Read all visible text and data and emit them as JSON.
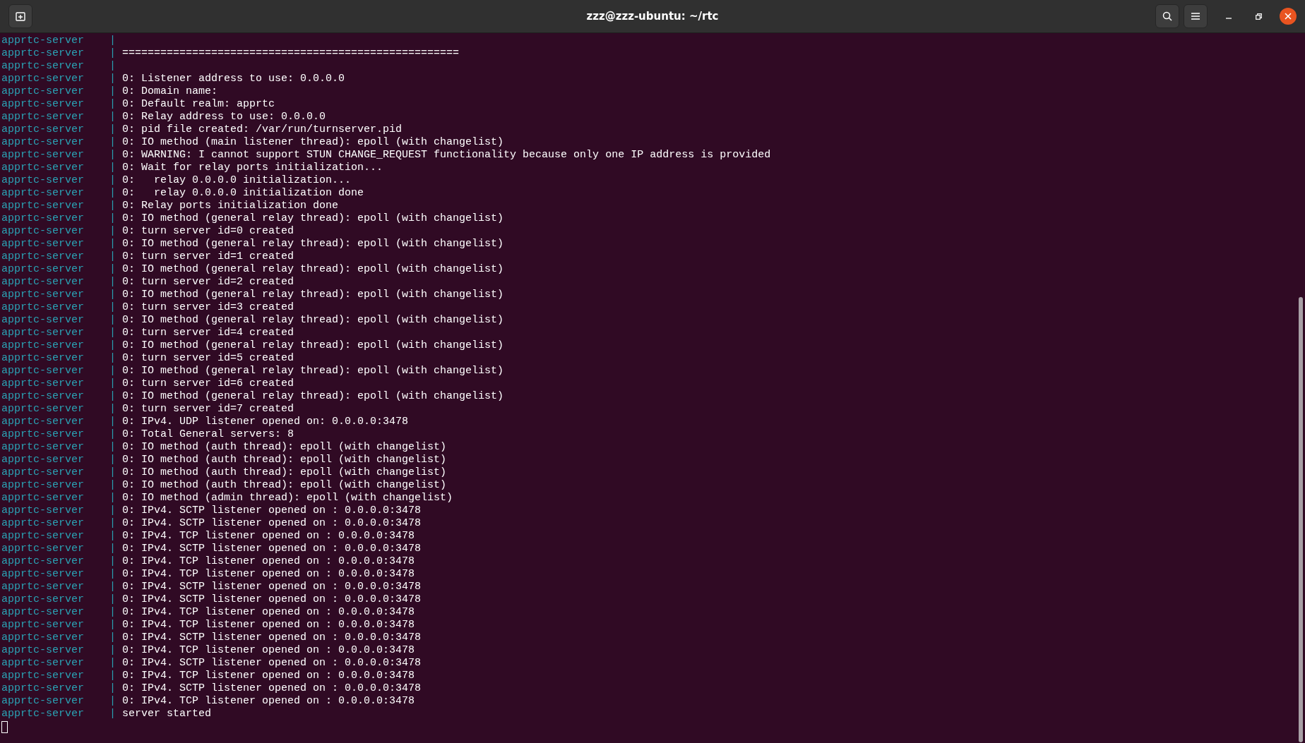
{
  "window": {
    "title": "zzz@zzz-ubuntu: ~/rtc"
  },
  "lines": [
    {
      "source": "apprtc-server",
      "separator": "|"
    },
    {
      "source": "apprtc-server",
      "separator": "|",
      "message": "====================================================="
    },
    {
      "source": "apprtc-server",
      "separator": "|"
    },
    {
      "source": "apprtc-server",
      "separator": "|",
      "message": "0: Listener address to use: 0.0.0.0"
    },
    {
      "source": "apprtc-server",
      "separator": "|",
      "message": "0: Domain name:"
    },
    {
      "source": "apprtc-server",
      "separator": "|",
      "message": "0: Default realm: apprtc"
    },
    {
      "source": "apprtc-server",
      "separator": "|",
      "message": "0: Relay address to use: 0.0.0.0"
    },
    {
      "source": "apprtc-server",
      "separator": "|",
      "message": "0: pid file created: /var/run/turnserver.pid"
    },
    {
      "source": "apprtc-server",
      "separator": "|",
      "message": "0: IO method (main listener thread): epoll (with changelist)"
    },
    {
      "source": "apprtc-server",
      "separator": "|",
      "message": "0: WARNING: I cannot support STUN CHANGE_REQUEST functionality because only one IP address is provided"
    },
    {
      "source": "apprtc-server",
      "separator": "|",
      "message": "0: Wait for relay ports initialization..."
    },
    {
      "source": "apprtc-server",
      "separator": "|",
      "message": "0:   relay 0.0.0.0 initialization..."
    },
    {
      "source": "apprtc-server",
      "separator": "|",
      "message": "0:   relay 0.0.0.0 initialization done"
    },
    {
      "source": "apprtc-server",
      "separator": "|",
      "message": "0: Relay ports initialization done"
    },
    {
      "source": "apprtc-server",
      "separator": "|",
      "message": "0: IO method (general relay thread): epoll (with changelist)"
    },
    {
      "source": "apprtc-server",
      "separator": "|",
      "message": "0: turn server id=0 created"
    },
    {
      "source": "apprtc-server",
      "separator": "|",
      "message": "0: IO method (general relay thread): epoll (with changelist)"
    },
    {
      "source": "apprtc-server",
      "separator": "|",
      "message": "0: turn server id=1 created"
    },
    {
      "source": "apprtc-server",
      "separator": "|",
      "message": "0: IO method (general relay thread): epoll (with changelist)"
    },
    {
      "source": "apprtc-server",
      "separator": "|",
      "message": "0: turn server id=2 created"
    },
    {
      "source": "apprtc-server",
      "separator": "|",
      "message": "0: IO method (general relay thread): epoll (with changelist)"
    },
    {
      "source": "apprtc-server",
      "separator": "|",
      "message": "0: turn server id=3 created"
    },
    {
      "source": "apprtc-server",
      "separator": "|",
      "message": "0: IO method (general relay thread): epoll (with changelist)"
    },
    {
      "source": "apprtc-server",
      "separator": "|",
      "message": "0: turn server id=4 created"
    },
    {
      "source": "apprtc-server",
      "separator": "|",
      "message": "0: IO method (general relay thread): epoll (with changelist)"
    },
    {
      "source": "apprtc-server",
      "separator": "|",
      "message": "0: turn server id=5 created"
    },
    {
      "source": "apprtc-server",
      "separator": "|",
      "message": "0: IO method (general relay thread): epoll (with changelist)"
    },
    {
      "source": "apprtc-server",
      "separator": "|",
      "message": "0: turn server id=6 created"
    },
    {
      "source": "apprtc-server",
      "separator": "|",
      "message": "0: IO method (general relay thread): epoll (with changelist)"
    },
    {
      "source": "apprtc-server",
      "separator": "|",
      "message": "0: turn server id=7 created"
    },
    {
      "source": "apprtc-server",
      "separator": "|",
      "message": "0: IPv4. UDP listener opened on: 0.0.0.0:3478"
    },
    {
      "source": "apprtc-server",
      "separator": "|",
      "message": "0: Total General servers: 8"
    },
    {
      "source": "apprtc-server",
      "separator": "|",
      "message": "0: IO method (auth thread): epoll (with changelist)"
    },
    {
      "source": "apprtc-server",
      "separator": "|",
      "message": "0: IO method (auth thread): epoll (with changelist)"
    },
    {
      "source": "apprtc-server",
      "separator": "|",
      "message": "0: IO method (auth thread): epoll (with changelist)"
    },
    {
      "source": "apprtc-server",
      "separator": "|",
      "message": "0: IO method (auth thread): epoll (with changelist)"
    },
    {
      "source": "apprtc-server",
      "separator": "|",
      "message": "0: IO method (admin thread): epoll (with changelist)"
    },
    {
      "source": "apprtc-server",
      "separator": "|",
      "message": "0: IPv4. SCTP listener opened on : 0.0.0.0:3478"
    },
    {
      "source": "apprtc-server",
      "separator": "|",
      "message": "0: IPv4. SCTP listener opened on : 0.0.0.0:3478"
    },
    {
      "source": "apprtc-server",
      "separator": "|",
      "message": "0: IPv4. TCP listener opened on : 0.0.0.0:3478"
    },
    {
      "source": "apprtc-server",
      "separator": "|",
      "message": "0: IPv4. SCTP listener opened on : 0.0.0.0:3478"
    },
    {
      "source": "apprtc-server",
      "separator": "|",
      "message": "0: IPv4. TCP listener opened on : 0.0.0.0:3478"
    },
    {
      "source": "apprtc-server",
      "separator": "|",
      "message": "0: IPv4. TCP listener opened on : 0.0.0.0:3478"
    },
    {
      "source": "apprtc-server",
      "separator": "|",
      "message": "0: IPv4. SCTP listener opened on : 0.0.0.0:3478"
    },
    {
      "source": "apprtc-server",
      "separator": "|",
      "message": "0: IPv4. SCTP listener opened on : 0.0.0.0:3478"
    },
    {
      "source": "apprtc-server",
      "separator": "|",
      "message": "0: IPv4. TCP listener opened on : 0.0.0.0:3478"
    },
    {
      "source": "apprtc-server",
      "separator": "|",
      "message": "0: IPv4. TCP listener opened on : 0.0.0.0:3478"
    },
    {
      "source": "apprtc-server",
      "separator": "|",
      "message": "0: IPv4. SCTP listener opened on : 0.0.0.0:3478"
    },
    {
      "source": "apprtc-server",
      "separator": "|",
      "message": "0: IPv4. TCP listener opened on : 0.0.0.0:3478"
    },
    {
      "source": "apprtc-server",
      "separator": "|",
      "message": "0: IPv4. SCTP listener opened on : 0.0.0.0:3478"
    },
    {
      "source": "apprtc-server",
      "separator": "|",
      "message": "0: IPv4. TCP listener opened on : 0.0.0.0:3478"
    },
    {
      "source": "apprtc-server",
      "separator": "|",
      "message": "0: IPv4. SCTP listener opened on : 0.0.0.0:3478"
    },
    {
      "source": "apprtc-server",
      "separator": "|",
      "message": "0: IPv4. TCP listener opened on : 0.0.0.0:3478"
    },
    {
      "source": "apprtc-server",
      "separator": "|",
      "message": "server started"
    }
  ]
}
